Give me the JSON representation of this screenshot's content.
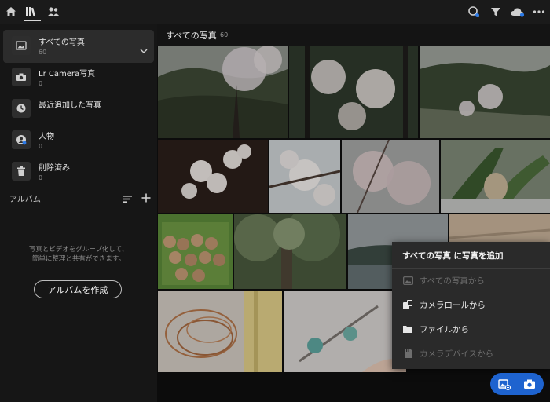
{
  "topbar": {
    "icons": [
      "home-icon",
      "library-icon",
      "people-icon",
      "search-people-icon",
      "filter-icon",
      "cloud-icon",
      "more-icon"
    ]
  },
  "sidebar": {
    "items": [
      {
        "label": "すべての写真",
        "count": "60",
        "icon": "photos-icon",
        "active": true
      },
      {
        "label": "Lr Camera写真",
        "count": "0",
        "icon": "camera-icon"
      },
      {
        "label": "最近追加した写真",
        "count": "",
        "icon": "clock-icon"
      },
      {
        "label": "人物",
        "count": "0",
        "icon": "person-icon"
      },
      {
        "label": "削除済み",
        "count": "0",
        "icon": "trash-icon"
      }
    ],
    "albums_title": "アルバム",
    "empty_message_line1": "写真とビデオをグループ化して、",
    "empty_message_line2": "簡単に整理と共有ができます。",
    "create_album_label": "アルバムを作成"
  },
  "main": {
    "title": "すべての写真",
    "count": "60"
  },
  "add_menu": {
    "title": "すべての写真 に写真を追加",
    "items": [
      {
        "label": "すべての写真から",
        "icon": "photos-icon",
        "enabled": false
      },
      {
        "label": "カメラロールから",
        "icon": "camera-roll-icon",
        "enabled": true
      },
      {
        "label": "ファイルから",
        "icon": "folder-icon",
        "enabled": true
      },
      {
        "label": "カメラデバイスから",
        "icon": "sd-card-icon",
        "enabled": false
      }
    ]
  },
  "fab": {
    "icons": [
      "add-photo-icon",
      "camera-icon"
    ],
    "color": "#1e63cf"
  }
}
